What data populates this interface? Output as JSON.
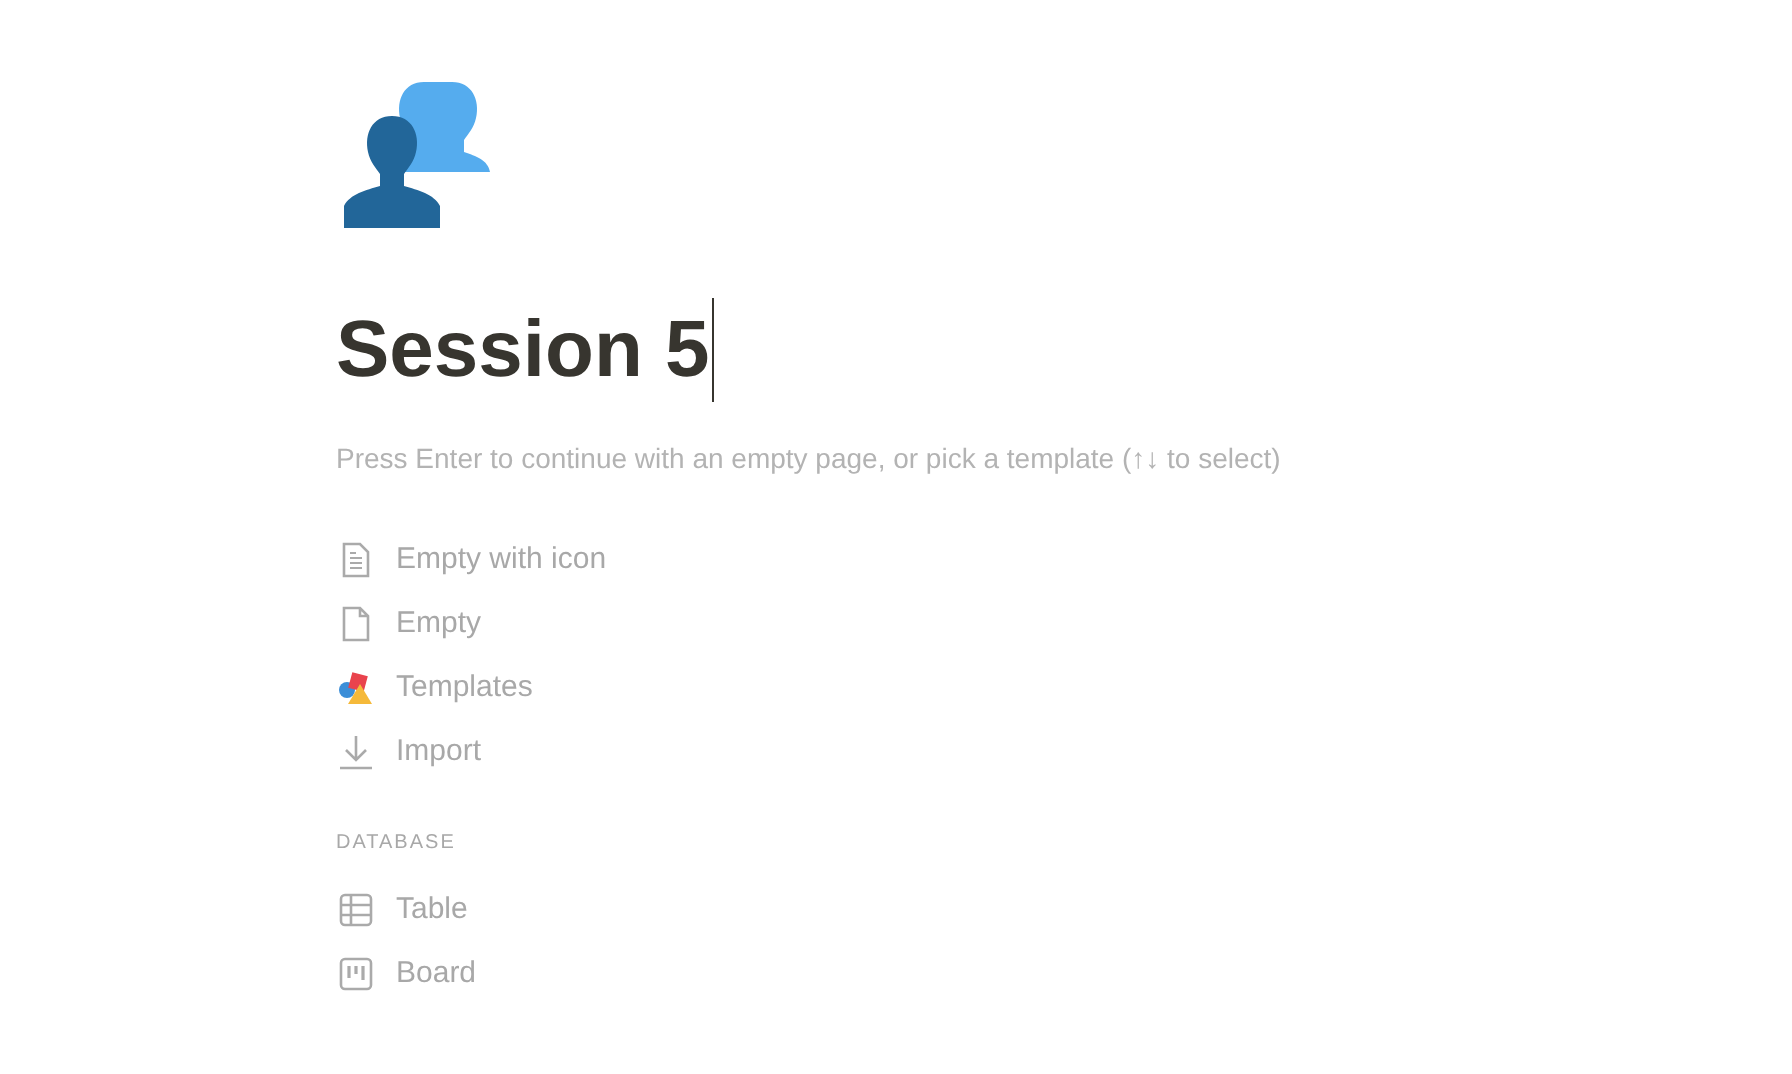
{
  "page": {
    "title": "Session 5",
    "hint": "Press Enter to continue with an empty page, or pick a template (↑↓ to select)"
  },
  "options": [
    {
      "kind": "doc-lines",
      "label": "Empty with icon"
    },
    {
      "kind": "doc",
      "label": "Empty"
    },
    {
      "kind": "templates",
      "label": "Templates"
    },
    {
      "kind": "import",
      "label": "Import"
    }
  ],
  "database": {
    "heading": "DATABASE",
    "items": [
      {
        "kind": "table",
        "label": "Table"
      },
      {
        "kind": "board",
        "label": "Board"
      }
    ]
  }
}
